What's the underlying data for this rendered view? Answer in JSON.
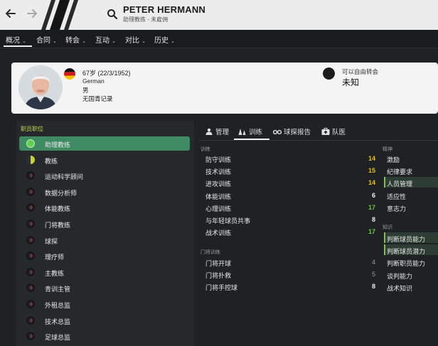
{
  "header": {
    "back_icon": "arrow-left-icon",
    "forward_icon": "arrow-right-icon",
    "staff_icon": "search-icon",
    "name": "PETER HERMANN",
    "subtitle": "助理教练 - 未雇佣"
  },
  "menu": [
    {
      "label": "概况"
    },
    {
      "label": "合同"
    },
    {
      "label": "转会"
    },
    {
      "label": "互动"
    },
    {
      "label": "对比"
    },
    {
      "label": "历史"
    }
  ],
  "profile": {
    "age_line": "67岁 (22/3/1952)",
    "nationality": "German",
    "gender": "男",
    "youth_record": "无国青记录",
    "transfer_status_label": "可以自由转会",
    "transfer_value": "未知"
  },
  "roles": {
    "header": "职员职位",
    "items": [
      {
        "label": "助理教练",
        "rating": "full",
        "selected": true
      },
      {
        "label": "教练",
        "rating": "half"
      },
      {
        "label": "运动科学顾问",
        "rating": "low"
      },
      {
        "label": "数据分析师",
        "rating": "low"
      },
      {
        "label": "体能教练",
        "rating": "low"
      },
      {
        "label": "门将教练",
        "rating": "low"
      },
      {
        "label": "球探",
        "rating": "low"
      },
      {
        "label": "理疗师",
        "rating": "low"
      },
      {
        "label": "主教练",
        "rating": "low"
      },
      {
        "label": "青训主管",
        "rating": "low"
      },
      {
        "label": "外租总监",
        "rating": "low"
      },
      {
        "label": "技术总监",
        "rating": "low"
      },
      {
        "label": "足球总监",
        "rating": "low"
      }
    ]
  },
  "tabs": [
    {
      "label": "管理",
      "icon": "people-icon"
    },
    {
      "label": "训练",
      "icon": "cones-icon",
      "active": true
    },
    {
      "label": "球探报告",
      "icon": "binoculars-icon"
    },
    {
      "label": "队医",
      "icon": "medical-kit-icon"
    }
  ],
  "attributes": {
    "training_title": "训练",
    "training": [
      {
        "name": "防守训练",
        "value": "14",
        "color": "yellow"
      },
      {
        "name": "技术训练",
        "value": "15",
        "color": "yellow"
      },
      {
        "name": "进攻训练",
        "value": "14",
        "color": "yellow"
      },
      {
        "name": "体能训练",
        "value": "6",
        "color": "white"
      },
      {
        "name": "心理训练",
        "value": "17",
        "color": "green"
      },
      {
        "name": "与年轻球员共事",
        "value": "8",
        "color": "white"
      },
      {
        "name": "战术训练",
        "value": "17",
        "color": "green"
      }
    ],
    "gk_title": "门将训练",
    "goalkeeping": [
      {
        "name": "门将开球",
        "value": "4",
        "color": "grey"
      },
      {
        "name": "门将扑救",
        "value": "5",
        "color": "grey"
      },
      {
        "name": "门将手控球",
        "value": "8",
        "color": "white"
      }
    ],
    "mental_title": "精神",
    "mental": [
      {
        "name": "激励"
      },
      {
        "name": "纪律要求"
      },
      {
        "name": "人员管理",
        "highlight": true
      },
      {
        "name": "适应性"
      },
      {
        "name": "意志力"
      }
    ],
    "knowledge_title": "知识",
    "knowledge": [
      {
        "name": "判断球员能力",
        "highlight": true
      },
      {
        "name": "判断球员潜力",
        "highlight": true
      },
      {
        "name": "判断职员能力"
      },
      {
        "name": "谈判能力"
      },
      {
        "name": "战术知识"
      }
    ]
  },
  "colors": {
    "accent_green": "#3d8a63",
    "value_yellow": "#e0c020",
    "value_green": "#6cc93f",
    "section_yellow": "#c8d84a"
  }
}
